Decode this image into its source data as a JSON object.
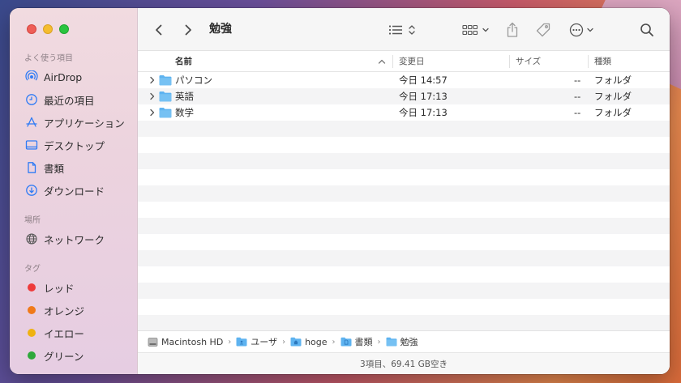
{
  "window": {
    "title": "勉強"
  },
  "sidebar": {
    "favorites_header": "よく使う項目",
    "favorites": [
      {
        "label": "AirDrop",
        "icon": "airdrop-icon"
      },
      {
        "label": "最近の項目",
        "icon": "clock-icon"
      },
      {
        "label": "アプリケーション",
        "icon": "applications-icon"
      },
      {
        "label": "デスクトップ",
        "icon": "desktop-icon"
      },
      {
        "label": "書類",
        "icon": "document-icon"
      },
      {
        "label": "ダウンロード",
        "icon": "download-icon"
      }
    ],
    "locations_header": "場所",
    "locations": [
      {
        "label": "ネットワーク",
        "icon": "network-globe-icon"
      }
    ],
    "tags_header": "タグ",
    "tags": [
      {
        "label": "レッド",
        "color": "#ee3b3b"
      },
      {
        "label": "オレンジ",
        "color": "#f07a1a"
      },
      {
        "label": "イエロー",
        "color": "#efb211"
      },
      {
        "label": "グリーン",
        "color": "#2ea83b"
      }
    ]
  },
  "columns": {
    "name": "名前",
    "modified": "変更日",
    "size": "サイズ",
    "kind": "種類"
  },
  "files": [
    {
      "name": "パソコン",
      "modified": "今日 14:57",
      "size": "--",
      "kind": "フォルダ"
    },
    {
      "name": "英語",
      "modified": "今日 17:13",
      "size": "--",
      "kind": "フォルダ"
    },
    {
      "name": "数学",
      "modified": "今日 17:13",
      "size": "--",
      "kind": "フォルダ"
    }
  ],
  "pathbar": [
    {
      "label": "Macintosh HD",
      "icon": "hard-drive-icon"
    },
    {
      "label": "ユーザ",
      "icon": "users-folder-icon"
    },
    {
      "label": "hoge",
      "icon": "home-folder-icon"
    },
    {
      "label": "書類",
      "icon": "documents-folder-icon"
    },
    {
      "label": "勉強",
      "icon": "folder-icon"
    }
  ],
  "status": "3項目、69.41 GB空き",
  "colors": {
    "accent": "#2f7bf5",
    "folder": "#5eb3f0",
    "sidebar_bg": "#ecd3de"
  }
}
